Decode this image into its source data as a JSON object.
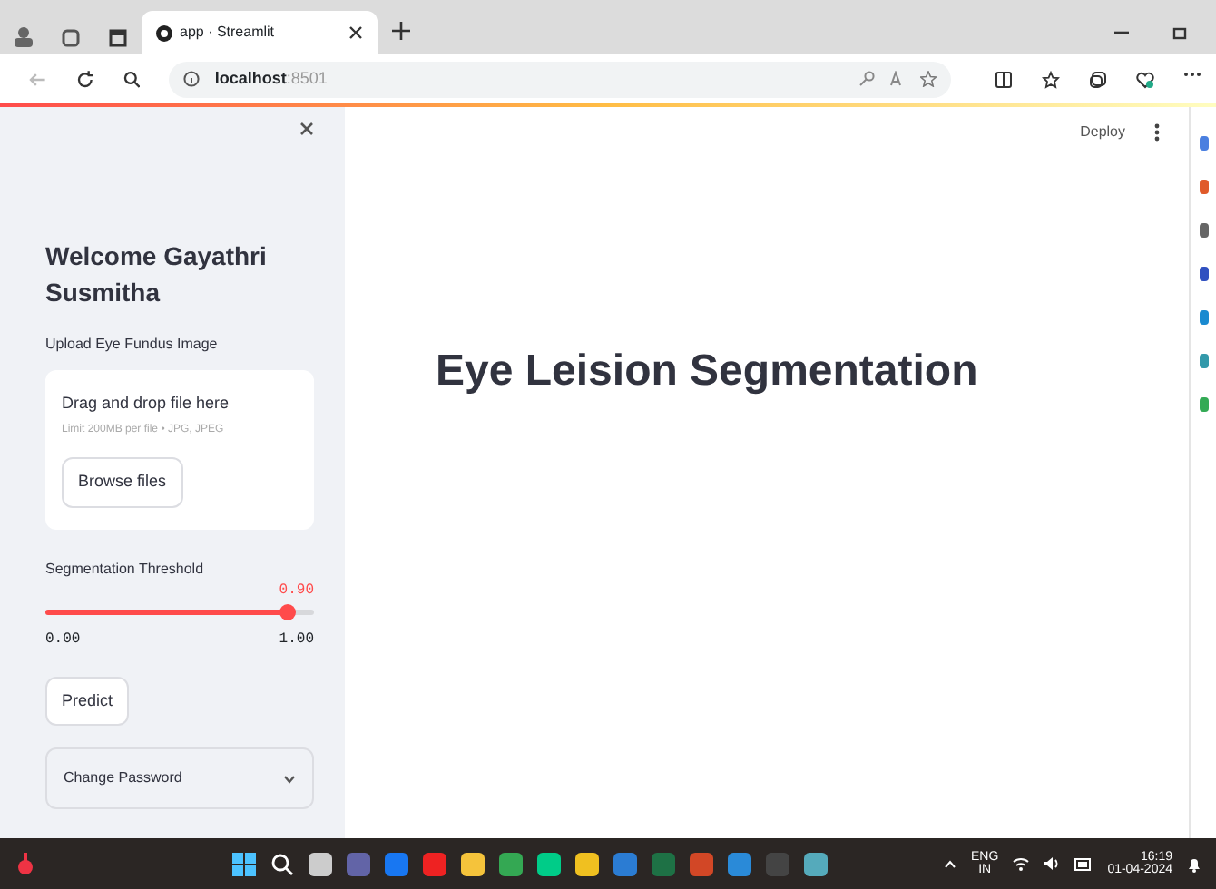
{
  "browser": {
    "tabs": [
      {
        "title": "app · Streamlit",
        "selected": true
      }
    ],
    "address": {
      "host": "localhost",
      "port": ":8501"
    }
  },
  "sidebar": {
    "heading": "Welcome Gayathri Susmitha",
    "upload_label": "Upload Eye Fundus Image",
    "dropzone": {
      "title": "Drag and drop file here",
      "hint": "Limit 200MB per file • JPG, JPEG",
      "button": "Browse files"
    },
    "slider": {
      "label": "Segmentation Threshold",
      "value": "0.90",
      "min": "0.00",
      "max": "1.00",
      "level": 0.9
    },
    "predict_button": "Predict",
    "expander": {
      "label": "Change Password",
      "expanded": false
    }
  },
  "toolbar": {
    "deploy": "Deploy"
  },
  "main": {
    "title": "Eye Leision Segmentation"
  },
  "taskbar": {
    "language": "ENG",
    "region": "IN",
    "time": "16:19",
    "date": "01-04-2024"
  }
}
